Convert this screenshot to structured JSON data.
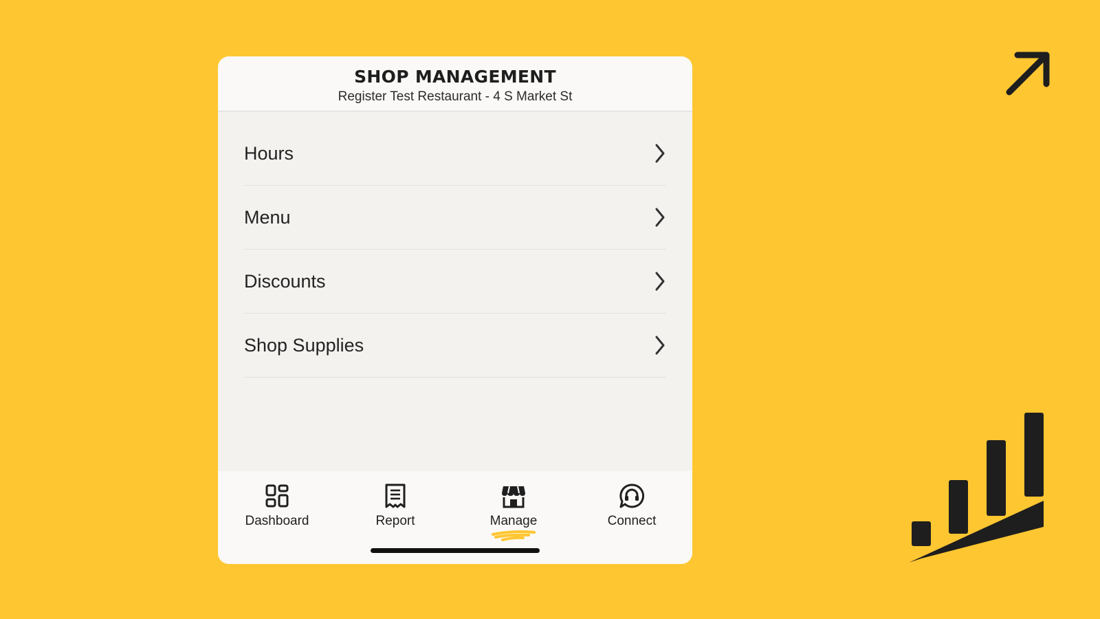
{
  "header": {
    "title": "SHOP MANAGEMENT",
    "subtitle": "Register Test Restaurant - 4 S Market St"
  },
  "list": {
    "items": [
      {
        "label": "Hours",
        "icon": "chevron-right-icon"
      },
      {
        "label": "Menu",
        "icon": "chevron-right-icon"
      },
      {
        "label": "Discounts",
        "icon": "chevron-right-icon"
      },
      {
        "label": "Shop Supplies",
        "icon": "chevron-right-icon"
      }
    ]
  },
  "tabbar": {
    "tabs": [
      {
        "label": "Dashboard",
        "icon": "dashboard-grid-icon"
      },
      {
        "label": "Report",
        "icon": "receipt-icon"
      },
      {
        "label": "Manage",
        "icon": "storefront-icon",
        "active": true
      },
      {
        "label": "Connect",
        "icon": "headset-chat-icon"
      }
    ]
  },
  "colors": {
    "background": "#FEC631",
    "accent": "#FEC631",
    "text": "#1F1F1F",
    "panel": "#F4F2EF"
  },
  "decorations": [
    "arrow-up-right-icon",
    "bar-chart-logo-icon"
  ]
}
